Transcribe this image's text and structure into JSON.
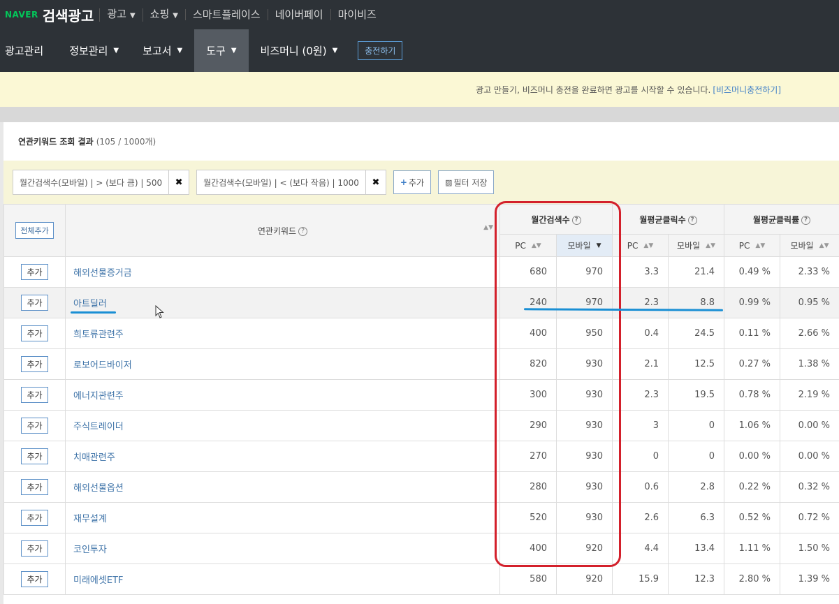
{
  "header": {
    "naver": "NAVER",
    "title": "검색광고",
    "menu": [
      "광고",
      "쇼핑",
      "스마트플레이스",
      "네이버페이",
      "마이비즈"
    ]
  },
  "nav": {
    "items": [
      "광고관리",
      "정보관리",
      "보고서",
      "도구"
    ],
    "bizmoney": "비즈머니 (0원)",
    "charge": "충전하기"
  },
  "notice": {
    "text": "광고 만들기, 비즈머니 충전을 완료하면 광고를 시작할 수 있습니다.",
    "link": "[비즈머니충전하기]"
  },
  "result": {
    "title": "연관키워드 조회 결과",
    "count": "(105 / 1000개)"
  },
  "filters": {
    "chip1": "월간검색수(모바일) | > (보다 큼) | 500",
    "chip2": "월간검색수(모바일) | < (보다 작음) | 1000",
    "add": "추가",
    "save": "필터 저장"
  },
  "table": {
    "all_add": "전체추가",
    "kw_header": "연관키워드",
    "groups": [
      "월간검색수",
      "월평균클릭수",
      "월평균클릭률"
    ],
    "sub": {
      "pc": "PC",
      "mobile": "모바일"
    },
    "add_label": "추가",
    "rows": [
      {
        "kw": "해외선물증거금",
        "s_pc": "680",
        "s_mo": "970",
        "c_pc": "3.3",
        "c_mo": "21.4",
        "r_pc": "0.49 %",
        "r_mo": "2.33 %"
      },
      {
        "kw": "아트딜러",
        "s_pc": "240",
        "s_mo": "970",
        "c_pc": "2.3",
        "c_mo": "8.8",
        "r_pc": "0.99 %",
        "r_mo": "0.95 %"
      },
      {
        "kw": "희토류관련주",
        "s_pc": "400",
        "s_mo": "950",
        "c_pc": "0.4",
        "c_mo": "24.5",
        "r_pc": "0.11 %",
        "r_mo": "2.66 %"
      },
      {
        "kw": "로보어드바이저",
        "s_pc": "820",
        "s_mo": "930",
        "c_pc": "2.1",
        "c_mo": "12.5",
        "r_pc": "0.27 %",
        "r_mo": "1.38 %"
      },
      {
        "kw": "에너지관련주",
        "s_pc": "300",
        "s_mo": "930",
        "c_pc": "2.3",
        "c_mo": "19.5",
        "r_pc": "0.78 %",
        "r_mo": "2.19 %"
      },
      {
        "kw": "주식트레이더",
        "s_pc": "290",
        "s_mo": "930",
        "c_pc": "3",
        "c_mo": "0",
        "r_pc": "1.06 %",
        "r_mo": "0.00 %"
      },
      {
        "kw": "치매관련주",
        "s_pc": "270",
        "s_mo": "930",
        "c_pc": "0",
        "c_mo": "0",
        "r_pc": "0.00 %",
        "r_mo": "0.00 %"
      },
      {
        "kw": "해외선물옵션",
        "s_pc": "280",
        "s_mo": "930",
        "c_pc": "0.6",
        "c_mo": "2.8",
        "r_pc": "0.22 %",
        "r_mo": "0.32 %"
      },
      {
        "kw": "재무설계",
        "s_pc": "520",
        "s_mo": "930",
        "c_pc": "2.6",
        "c_mo": "6.3",
        "r_pc": "0.52 %",
        "r_mo": "0.72 %"
      },
      {
        "kw": "코인투자",
        "s_pc": "400",
        "s_mo": "920",
        "c_pc": "4.4",
        "c_mo": "13.4",
        "r_pc": "1.11 %",
        "r_mo": "1.50 %"
      },
      {
        "kw": "미래에셋ETF",
        "s_pc": "580",
        "s_mo": "920",
        "c_pc": "15.9",
        "c_mo": "12.3",
        "r_pc": "2.80 %",
        "r_mo": "1.39 %"
      }
    ]
  },
  "colors": {
    "topbar": "#2d3237",
    "highlight_red": "#d3202b",
    "underline_blue": "#1a8fd4",
    "keyword_link": "#3e73a8",
    "notice_bg": "#fbf8d5"
  }
}
